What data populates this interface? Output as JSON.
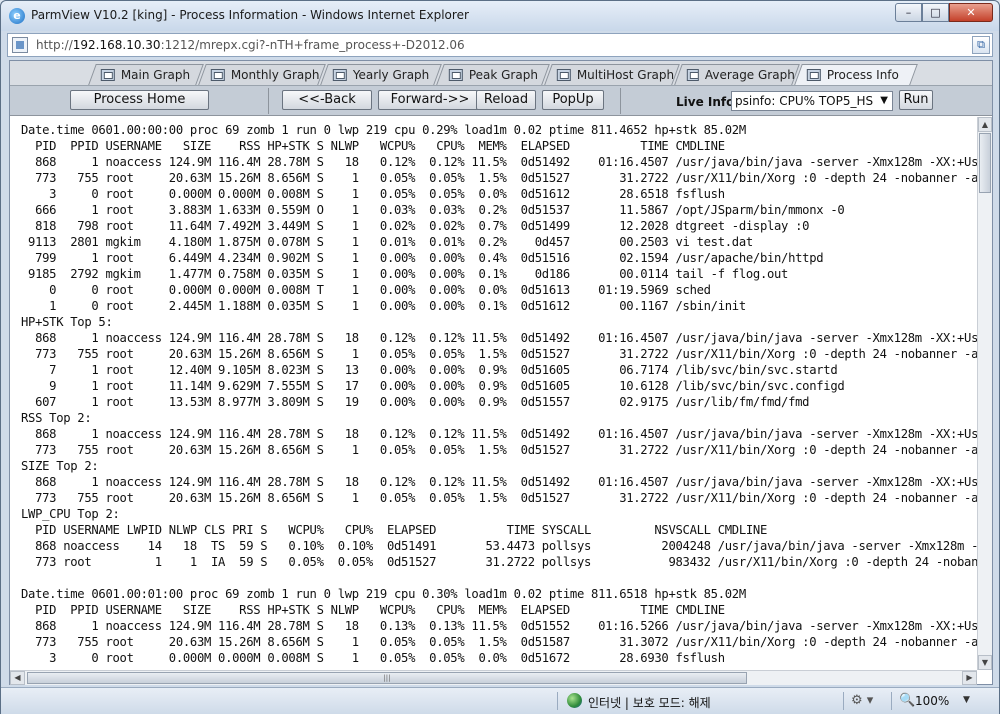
{
  "window": {
    "title": "ParmView V10.2 [king] - Process Information - Windows Internet Explorer",
    "minimize": "–",
    "maximize": "□",
    "close": "✕"
  },
  "address": {
    "scheme": "http://",
    "host": "192.168.10.30",
    "path": ":1212/mrepx.cgi?-nTH+frame_process+-D2012.06"
  },
  "tabs": [
    {
      "label": "Main Graph"
    },
    {
      "label": "Monthly Graph"
    },
    {
      "label": "Yearly Graph"
    },
    {
      "label": "Peak Graph"
    },
    {
      "label": "MultiHost Graph"
    },
    {
      "label": "Average Graph"
    },
    {
      "label": "Process Info"
    }
  ],
  "toolbar": {
    "process_home": "Process Home",
    "back": "<<-Back",
    "forward": "Forward->>",
    "reload": "Reload",
    "popup": "PopUp",
    "live_info_label": "Live Info:",
    "live_info_value": "psinfo: CPU% TOP5_HS",
    "run": "Run"
  },
  "output_text": "Date.time 0601.00:00:00 proc 69 zomb 1 run 0 lwp 219 cpu 0.29% load1m 0.02 ptime 811.4652 hp+stk 85.02M\n  PID  PPID USERNAME   SIZE    RSS HP+STK S NLWP   WCPU%   CPU%  MEM%  ELAPSED          TIME CMDLINE\n  868     1 noaccess 124.9M 116.4M 28.78M S   18   0.12%  0.12% 11.5%  0d51492    01:16.4507 /usr/java/bin/java -server -Xmx128m -XX:+Us\n  773   755 root     20.63M 15.26M 8.656M S    1   0.05%  0.05%  1.5%  0d51527       31.2722 /usr/X11/bin/Xorg :0 -depth 24 -nobanner -a\n    3     0 root     0.000M 0.000M 0.008M S    1   0.05%  0.05%  0.0%  0d51612       28.6518 fsflush\n  666     1 root     3.883M 1.633M 0.559M O    1   0.03%  0.03%  0.2%  0d51537       11.5867 /opt/JSparm/bin/mmonx -0\n  818   798 root     11.64M 7.492M 3.449M S    1   0.02%  0.02%  0.7%  0d51499       12.2028 dtgreet -display :0\n 9113  2801 mgkim    4.180M 1.875M 0.078M S    1   0.01%  0.01%  0.2%    0d457       00.2503 vi test.dat\n  799     1 root     6.449M 4.234M 0.902M S    1   0.00%  0.00%  0.4%  0d51516       02.1594 /usr/apache/bin/httpd\n 9185  2792 mgkim    1.477M 0.758M 0.035M S    1   0.00%  0.00%  0.1%    0d186       00.0114 tail -f flog.out\n    0     0 root     0.000M 0.000M 0.008M T    1   0.00%  0.00%  0.0%  0d51613    01:19.5969 sched\n    1     0 root     2.445M 1.188M 0.035M S    1   0.00%  0.00%  0.1%  0d51612       00.1167 /sbin/init\nHP+STK Top 5:\n  868     1 noaccess 124.9M 116.4M 28.78M S   18   0.12%  0.12% 11.5%  0d51492    01:16.4507 /usr/java/bin/java -server -Xmx128m -XX:+Us\n  773   755 root     20.63M 15.26M 8.656M S    1   0.05%  0.05%  1.5%  0d51527       31.2722 /usr/X11/bin/Xorg :0 -depth 24 -nobanner -a\n    7     1 root     12.40M 9.105M 8.023M S   13   0.00%  0.00%  0.9%  0d51605       06.7174 /lib/svc/bin/svc.startd\n    9     1 root     11.14M 9.629M 7.555M S   17   0.00%  0.00%  0.9%  0d51605       10.6128 /lib/svc/bin/svc.configd\n  607     1 root     13.53M 8.977M 3.809M S   19   0.00%  0.00%  0.9%  0d51557       02.9175 /usr/lib/fm/fmd/fmd\nRSS Top 2:\n  868     1 noaccess 124.9M 116.4M 28.78M S   18   0.12%  0.12% 11.5%  0d51492    01:16.4507 /usr/java/bin/java -server -Xmx128m -XX:+Us\n  773   755 root     20.63M 15.26M 8.656M S    1   0.05%  0.05%  1.5%  0d51527       31.2722 /usr/X11/bin/Xorg :0 -depth 24 -nobanner -a\nSIZE Top 2:\n  868     1 noaccess 124.9M 116.4M 28.78M S   18   0.12%  0.12% 11.5%  0d51492    01:16.4507 /usr/java/bin/java -server -Xmx128m -XX:+Us\n  773   755 root     20.63M 15.26M 8.656M S    1   0.05%  0.05%  1.5%  0d51527       31.2722 /usr/X11/bin/Xorg :0 -depth 24 -nobanner -a\nLWP_CPU Top 2:\n  PID USERNAME LWPID NLWP CLS PRI S   WCPU%   CPU%  ELAPSED          TIME SYSCALL         NSVSCALL CMDLINE\n  868 noaccess    14   18  TS  59 S   0.10%  0.10%  0d51491       53.4473 pollsys          2004248 /usr/java/bin/java -server -Xmx128m -\n  773 root         1    1  IA  59 S   0.05%  0.05%  0d51527       31.2722 pollsys           983432 /usr/X11/bin/Xorg :0 -depth 24 -noban\n\nDate.time 0601.00:01:00 proc 69 zomb 1 run 0 lwp 219 cpu 0.30% load1m 0.02 ptime 811.6518 hp+stk 85.02M\n  PID  PPID USERNAME   SIZE    RSS HP+STK S NLWP   WCPU%   CPU%  MEM%  ELAPSED          TIME CMDLINE\n  868     1 noaccess 124.9M 116.4M 28.78M S   18   0.13%  0.13% 11.5%  0d51552    01:16.5266 /usr/java/bin/java -server -Xmx128m -XX:+Us\n  773   755 root     20.63M 15.26M 8.656M S    1   0.05%  0.05%  1.5%  0d51587       31.3072 /usr/X11/bin/Xorg :0 -depth 24 -nobanner -a\n    3     0 root     0.000M 0.000M 0.008M S    1   0.05%  0.05%  0.0%  0d51672       28.6930 fsflush",
  "status": {
    "zone": "인터넷 | 보호 모드: 해제",
    "zoom": "100%"
  }
}
